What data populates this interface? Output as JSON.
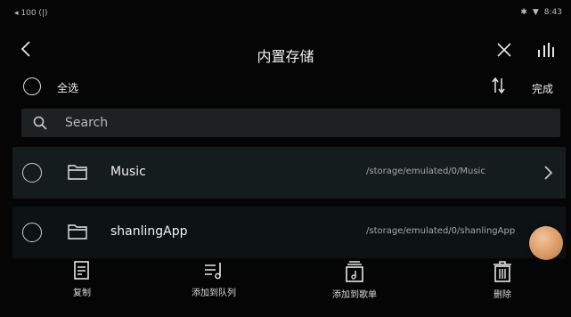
{
  "status": {
    "left": "◂ 100 (|)",
    "right_time": "8:43"
  },
  "header": {
    "title": "内置存储"
  },
  "select_all": {
    "label": "全选"
  },
  "toolbar": {
    "done_label": "完成"
  },
  "search": {
    "placeholder": "Search"
  },
  "files": [
    {
      "name": "Music",
      "path": "/storage/emulated/0/Music"
    },
    {
      "name": "shanlingApp",
      "path": "/storage/emulated/0/shanlingApp"
    }
  ],
  "actions": [
    {
      "label": "复制",
      "icon": "copy-icon"
    },
    {
      "label": "添加到队列",
      "icon": "add-to-queue-icon"
    },
    {
      "label": "添加到歌单",
      "icon": "add-to-playlist-icon"
    },
    {
      "label": "删除",
      "icon": "trash-icon"
    }
  ]
}
